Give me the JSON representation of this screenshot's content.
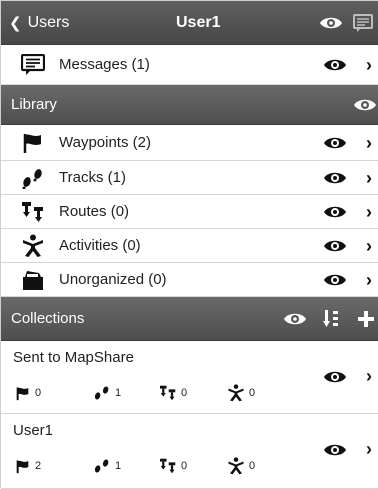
{
  "header": {
    "back_label": "Users",
    "title": "User1"
  },
  "messages": {
    "label": "Messages (1)"
  },
  "library": {
    "header": "Library",
    "items": [
      {
        "label": "Waypoints (2)",
        "icon": "flag-icon"
      },
      {
        "label": "Tracks (1)",
        "icon": "footprints-icon"
      },
      {
        "label": "Routes (0)",
        "icon": "route-pin-icon"
      },
      {
        "label": "Activities (0)",
        "icon": "person-activity-icon"
      },
      {
        "label": "Unorganized (0)",
        "icon": "folder-icon"
      }
    ]
  },
  "collections": {
    "header": "Collections",
    "items": [
      {
        "name": "Sent to MapShare",
        "waypoints": "0",
        "tracks": "1",
        "routes": "0",
        "activities": "0"
      },
      {
        "name": "User1",
        "waypoints": "2",
        "tracks": "1",
        "routes": "0",
        "activities": "0"
      }
    ]
  },
  "colors": {
    "bar": "#555555",
    "accent_white": "#ffffff",
    "text": "#1a1a1a"
  }
}
